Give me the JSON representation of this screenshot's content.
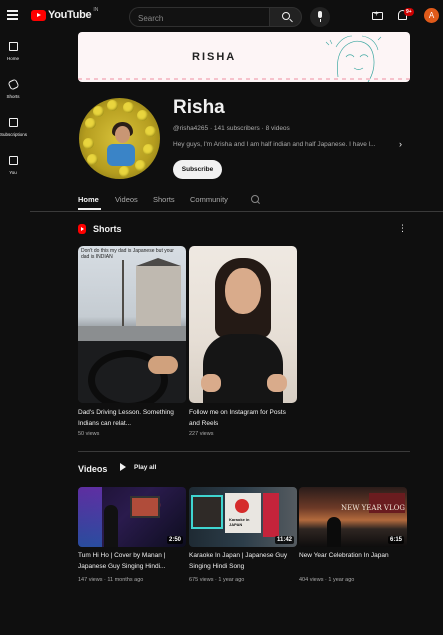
{
  "header": {
    "logo_text": "YouTube",
    "logo_country": "IN",
    "search": {
      "placeholder": "Search",
      "value": ""
    },
    "notification_count": "9+",
    "avatar_initial": "A"
  },
  "sidebar": {
    "items": [
      {
        "label": "Home",
        "icon": "home-icon"
      },
      {
        "label": "Shorts",
        "icon": "shorts-icon"
      },
      {
        "label": "Subscriptions",
        "icon": "subscriptions-icon"
      },
      {
        "label": "You",
        "icon": "you-icon"
      }
    ]
  },
  "banner": {
    "text": "RISHA"
  },
  "channel": {
    "name": "Risha",
    "handle": "@risha4265",
    "subscribers": "141 subscribers",
    "videos": "8 videos",
    "meta_line": "@risha4265 · 141 subscribers · 8 videos",
    "description": "Hey guys, I'm Arisha and I am half indian and half Japanese. I have l...",
    "subscribe_label": "Subscribe"
  },
  "tabs": [
    {
      "label": "Home",
      "active": true
    },
    {
      "label": "Videos",
      "active": false
    },
    {
      "label": "Shorts",
      "active": false
    },
    {
      "label": "Community",
      "active": false
    }
  ],
  "shorts_section": {
    "title": "Shorts",
    "items": [
      {
        "title": "Dad's Driving Lesson. Something Indians can relat...",
        "views": "50 views",
        "caption": "Don't do this my dad is Japanese but your dad is INDIAN"
      },
      {
        "title": "Follow me on Instagram for Posts and Reels",
        "views": "227 views"
      }
    ]
  },
  "videos_section": {
    "title": "Videos",
    "play_all_label": "Play all",
    "items": [
      {
        "title": "Tum Hi Ho | Cover by Manan | Japanese Guy Singing Hindi...",
        "duration": "2:50",
        "views": "147 views",
        "age": "11 months ago"
      },
      {
        "title": "Karaoke In Japan | Japanese Guy Singing Hindi Song",
        "duration": "11:42",
        "views": "675 views",
        "age": "1 year ago",
        "thumb_text": "Karaoke in JAPAN"
      },
      {
        "title": "New Year Celebration In Japan",
        "duration": "6:15",
        "views": "404 views",
        "age": "1 year ago",
        "thumb_text": "NEW YEAR VLOG"
      }
    ]
  },
  "colors": {
    "background": "#0f0f0f",
    "brand_red": "#ff0000",
    "text": "#f1f1f1",
    "secondary_text": "#aaaaaa"
  }
}
